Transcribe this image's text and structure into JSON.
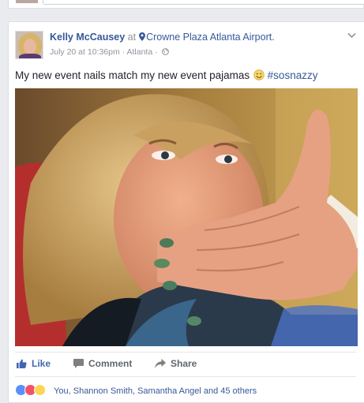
{
  "post": {
    "author": "Kelly McCausey",
    "at_word": "at",
    "place": "Crowne Plaza Atlanta Airport.",
    "timestamp": "July 20 at 10:36pm",
    "location": "Atlanta",
    "meta_separator": "·",
    "text_main": "My new event nails match my new event pajamas",
    "hashtag": "#sosnazzy"
  },
  "actions": {
    "like": "Like",
    "comment": "Comment",
    "share": "Share"
  },
  "reactions": {
    "summary": "You, Shannon Smith, Samantha Angel and 45 others",
    "icons": [
      "like-icon",
      "love-icon",
      "haha-icon"
    ]
  },
  "colors": {
    "link_blue": "#365899",
    "like_blue": "#4267b2",
    "muted": "#90949c",
    "background": "#e9ebee"
  }
}
